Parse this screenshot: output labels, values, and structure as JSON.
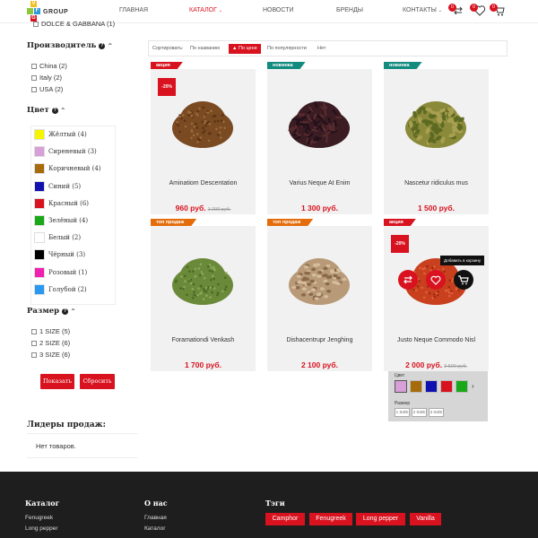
{
  "header": {
    "logo_letters": [
      "V",
      "F",
      "G"
    ],
    "logo_text": "GROUP",
    "nav": [
      {
        "label": "ГЛАВНАЯ",
        "active": false
      },
      {
        "label": "КАТАЛОГ",
        "active": true,
        "dropdown": true
      },
      {
        "label": "НОВОСТИ",
        "active": false
      },
      {
        "label": "БРЕНДЫ",
        "active": false
      },
      {
        "label": "КОНТАКТЫ",
        "active": false,
        "dropdown": true
      }
    ],
    "compare_count": "0",
    "wishlist_count": "0",
    "cart_count": "0",
    "accent_color": "#d8121f"
  },
  "filters": {
    "top_item": "DOLCE & GABBANA (1)",
    "manufacturer": {
      "title": "Производитель",
      "items": [
        {
          "label": "China (2)"
        },
        {
          "label": "Italy (2)"
        },
        {
          "label": "USA (2)"
        }
      ]
    },
    "color": {
      "title": "Цвет",
      "items": [
        {
          "label": "Жёлтый (4)",
          "hex": "#f5f500"
        },
        {
          "label": "Сиреневый (3)",
          "hex": "#d8a0d8"
        },
        {
          "label": "Коричневый (4)",
          "hex": "#a66b0a"
        },
        {
          "label": "Синий (5)",
          "hex": "#1010b0"
        },
        {
          "label": "Красный (6)",
          "hex": "#d8121f"
        },
        {
          "label": "Зелёный (4)",
          "hex": "#18a818"
        },
        {
          "label": "Белый (2)",
          "hex": "#ffffff"
        },
        {
          "label": "Чёрный (3)",
          "hex": "#000000"
        },
        {
          "label": "Розовый (1)",
          "hex": "#f020b0"
        },
        {
          "label": "Голубой (2)",
          "hex": "#2898f0"
        }
      ]
    },
    "size": {
      "title": "Размер",
      "items": [
        {
          "label": "1 SIZE (5)"
        },
        {
          "label": "2 SIZE (6)"
        },
        {
          "label": "3 SIZE (6)"
        }
      ]
    },
    "show_button": "Показать",
    "reset_button": "Сбросить"
  },
  "leaders": {
    "title": "Лидеры продаж:",
    "empty_text": "Нет товаров."
  },
  "sort": {
    "label": "Сортировать:",
    "options": [
      {
        "label": "По названию",
        "active": false
      },
      {
        "label": "▲ По цене",
        "active": true
      },
      {
        "label": "По популярности",
        "active": false
      },
      {
        "label": "Нет",
        "active": false
      }
    ]
  },
  "products": [
    {
      "badge": "акция",
      "badge_color": "red",
      "discount": "-20%",
      "name": "Aminatiom Descentation",
      "price": "960 руб.",
      "old_price": "1 200 руб.",
      "image": "ground-spice-brown"
    },
    {
      "badge": "новинка",
      "badge_color": "teal",
      "discount": "",
      "name": "Varius Neque At Enim",
      "price": "1 300 руб.",
      "old_price": "",
      "image": "cloves"
    },
    {
      "badge": "новинка",
      "badge_color": "teal",
      "discount": "",
      "name": "Nascetur ridiculus mus",
      "price": "1 500 руб.",
      "old_price": "",
      "image": "cardamom-pods"
    },
    {
      "badge": "топ продаж",
      "badge_color": "orange",
      "discount": "",
      "name": "Foramationdi Venkash",
      "price": "1 700 руб.",
      "old_price": "",
      "image": "dried-herbs"
    },
    {
      "badge": "топ продаж",
      "badge_color": "orange",
      "discount": "",
      "name": "Dishacentrupr Jenghing",
      "price": "2 100 руб.",
      "old_price": "",
      "image": "fenugreek-seeds"
    },
    {
      "badge": "акция",
      "badge_color": "red",
      "discount": "-20%",
      "name": "Justo Neque Commodo Nisl",
      "price": "2 000 руб.",
      "old_price": "2 500 руб.",
      "image": "paprika-powder"
    }
  ],
  "hovered_product": {
    "tooltip": "Добавить в корзину",
    "actions": [
      "compare-icon",
      "wishlist-icon",
      "cart-icon"
    ],
    "color_label": "Цвет",
    "colors": [
      "#d8a0d8",
      "#a66b0a",
      "#1010b0",
      "#d8121f",
      "#18a818"
    ],
    "size_label": "Размер",
    "sizes": [
      "1 SIZE",
      "2 SIZE",
      "3 SIZE"
    ]
  },
  "footer": {
    "catalog": {
      "title": "Каталог",
      "items": [
        "Fenugreek",
        "Long pepper"
      ]
    },
    "about": {
      "title": "О нас",
      "items": [
        "Главная",
        "Каталог"
      ]
    },
    "tags": {
      "title": "Тэги",
      "items": [
        "Camphor",
        "Fenugreek",
        "Long pepper",
        "Vanilla"
      ]
    }
  }
}
